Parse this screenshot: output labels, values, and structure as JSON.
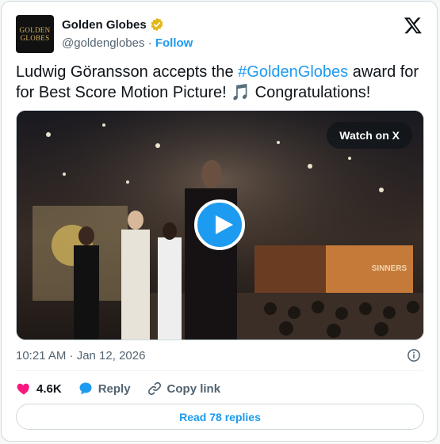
{
  "account": {
    "name": "Golden Globes",
    "handle": "@goldenglobes",
    "separator": "·",
    "follow_label": "Follow",
    "avatar_text_line1": "GOLDEN",
    "avatar_text_line2": "GLOBES"
  },
  "tweet": {
    "text_part1": "Ludwig Göransson accepts the ",
    "hashtag": "#GoldenGlobes",
    "text_part2": " award for for Best Score Motion Picture! 🎵 Congratulations!"
  },
  "media": {
    "watch_label": "Watch on X",
    "screen_caption": "SINNERS"
  },
  "meta": {
    "timestamp": "10:21 AM · Jan 12, 2026"
  },
  "actions": {
    "likes": "4.6K",
    "reply_label": "Reply",
    "copy_link_label": "Copy link"
  },
  "replies": {
    "label": "Read 78 replies"
  },
  "colors": {
    "accent": "#1d9bf0",
    "like": "#f91880",
    "verified_gold": "#e2b719"
  }
}
